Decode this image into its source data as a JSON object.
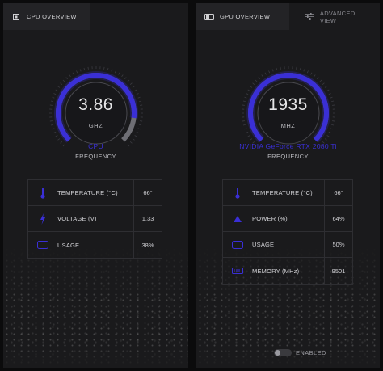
{
  "colors": {
    "accent": "#3a2fd6",
    "gaugeGray": "#6e6e74",
    "panel": "#1a1a1c"
  },
  "cpu": {
    "tab_label": "CPU OVERVIEW",
    "tab_icon": "chip-icon",
    "gauge": {
      "value": "3.86",
      "unit": "GHZ",
      "fill": 0.86
    },
    "device_name": "CPU",
    "freq_label": "FREQUENCY",
    "stats": [
      {
        "icon": "thermometer-icon",
        "label": "TEMPERATURE (°C)",
        "value": "66°"
      },
      {
        "icon": "lightning-icon",
        "label": "VOLTAGE (V)",
        "value": "1.33"
      },
      {
        "icon": "usage-icon",
        "label": "USAGE",
        "value": "38%"
      }
    ]
  },
  "gpu": {
    "tab_label": "GPU OVERVIEW",
    "tab_icon": "gpu-card-icon",
    "advanced_label": "ADVANCED VIEW",
    "advanced_icon": "sliders-icon",
    "gauge": {
      "value": "1935",
      "unit": "MHZ",
      "fill": 1.0
    },
    "device_name": "NVIDIA GeForce RTX 2080 Ti",
    "freq_label": "FREQUENCY",
    "stats": [
      {
        "icon": "thermometer-icon",
        "label": "TEMPERATURE (°C)",
        "value": "66°"
      },
      {
        "icon": "power-icon",
        "label": "POWER (%)",
        "value": "64%"
      },
      {
        "icon": "usage-icon",
        "label": "USAGE",
        "value": "50%"
      },
      {
        "icon": "memory-icon",
        "label": "MEMORY (MHz)",
        "value": "9501"
      }
    ],
    "toggle_label": "ENABLED"
  }
}
